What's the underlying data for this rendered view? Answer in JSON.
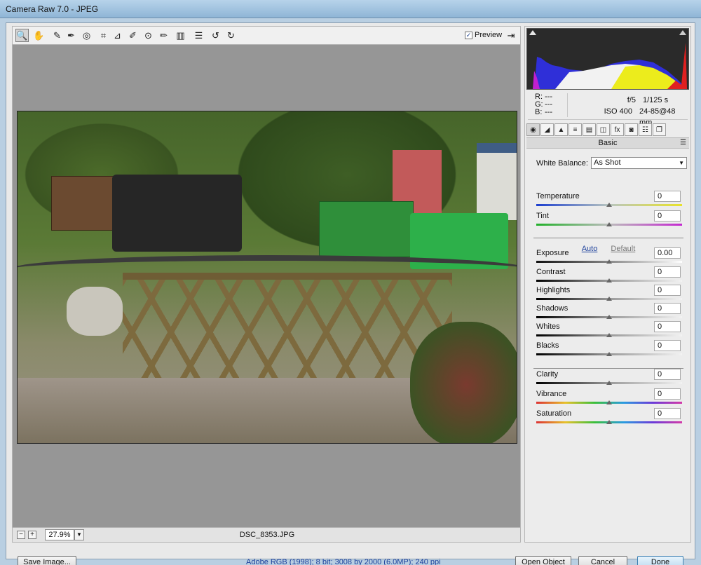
{
  "window": {
    "title": "Camera Raw 7.0  -  JPEG"
  },
  "toolbar": {
    "tools": [
      {
        "name": "zoom-tool-icon",
        "glyph": "🔍"
      },
      {
        "name": "hand-tool-icon",
        "glyph": "✋"
      },
      {
        "name": "white-balance-tool-icon",
        "glyph": "✎"
      },
      {
        "name": "color-sampler-tool-icon",
        "glyph": "✒"
      },
      {
        "name": "targeted-adjustment-tool-icon",
        "glyph": "◎"
      },
      {
        "name": "crop-tool-icon",
        "glyph": "⌗"
      },
      {
        "name": "straighten-tool-icon",
        "glyph": "⊿"
      },
      {
        "name": "spot-removal-tool-icon",
        "glyph": "✐"
      },
      {
        "name": "red-eye-removal-icon",
        "glyph": "⊙"
      },
      {
        "name": "adjustment-brush-icon",
        "glyph": "✏"
      },
      {
        "name": "graduated-filter-icon",
        "glyph": "▥"
      },
      {
        "name": "preferences-icon",
        "glyph": "☰"
      },
      {
        "name": "rotate-ccw-icon",
        "glyph": "↺"
      },
      {
        "name": "rotate-cw-icon",
        "glyph": "↻"
      }
    ],
    "preview_label": "Preview",
    "preview_checked": true
  },
  "status": {
    "zoom": "27.9%",
    "filename": "DSC_8353.JPG"
  },
  "info": {
    "r_label": "R:",
    "r_value": "---",
    "g_label": "G:",
    "g_value": "---",
    "b_label": "B:",
    "b_value": "---",
    "aperture": "f/5",
    "shutter": "1/125 s",
    "iso": "ISO 400",
    "lens": "24-85@48 mm"
  },
  "panel": {
    "tabs": [
      {
        "name": "basic-tab-icon",
        "glyph": "◉"
      },
      {
        "name": "tone-curve-tab-icon",
        "glyph": "◢"
      },
      {
        "name": "detail-tab-icon",
        "glyph": "▲"
      },
      {
        "name": "hsl-tab-icon",
        "glyph": "≡"
      },
      {
        "name": "split-toning-tab-icon",
        "glyph": "▤"
      },
      {
        "name": "lens-corrections-tab-icon",
        "glyph": "◫"
      },
      {
        "name": "effects-tab-icon",
        "glyph": "fx"
      },
      {
        "name": "camera-calibration-tab-icon",
        "glyph": "◙"
      },
      {
        "name": "presets-tab-icon",
        "glyph": "☷"
      },
      {
        "name": "snapshots-tab-icon",
        "glyph": "❐"
      }
    ],
    "header": "Basic",
    "white_balance_label": "White Balance:",
    "white_balance_value": "As Shot",
    "auto_label": "Auto",
    "default_label": "Default",
    "sliders": [
      {
        "id": "temperature",
        "label": "Temperature",
        "value": "0",
        "position": 0.5,
        "track": "temp"
      },
      {
        "id": "tint",
        "label": "Tint",
        "value": "0",
        "position": 0.5,
        "track": "tint"
      },
      {
        "id": "exposure",
        "label": "Exposure",
        "value": "0.00",
        "position": 0.5,
        "track": "exp"
      },
      {
        "id": "contrast",
        "label": "Contrast",
        "value": "0",
        "position": 0.5,
        "track": "tone"
      },
      {
        "id": "highlights",
        "label": "Highlights",
        "value": "0",
        "position": 0.5,
        "track": "tone"
      },
      {
        "id": "shadows",
        "label": "Shadows",
        "value": "0",
        "position": 0.5,
        "track": "tone"
      },
      {
        "id": "whites",
        "label": "Whites",
        "value": "0",
        "position": 0.5,
        "track": "tone"
      },
      {
        "id": "blacks",
        "label": "Blacks",
        "value": "0",
        "position": 0.5,
        "track": "tone"
      },
      {
        "id": "clarity",
        "label": "Clarity",
        "value": "0",
        "position": 0.5,
        "track": "tone"
      },
      {
        "id": "vibrance",
        "label": "Vibrance",
        "value": "0",
        "position": 0.5,
        "track": "rainbow"
      },
      {
        "id": "saturation",
        "label": "Saturation",
        "value": "0",
        "position": 0.5,
        "track": "rainbow"
      }
    ]
  },
  "footer": {
    "save_label": "Save Image...",
    "workflow_info": "Adobe RGB (1998); 8 bit; 3008 by 2000 (6.0MP); 240 ppi",
    "open_label": "Open Object",
    "cancel_label": "Cancel",
    "done_label": "Done"
  }
}
